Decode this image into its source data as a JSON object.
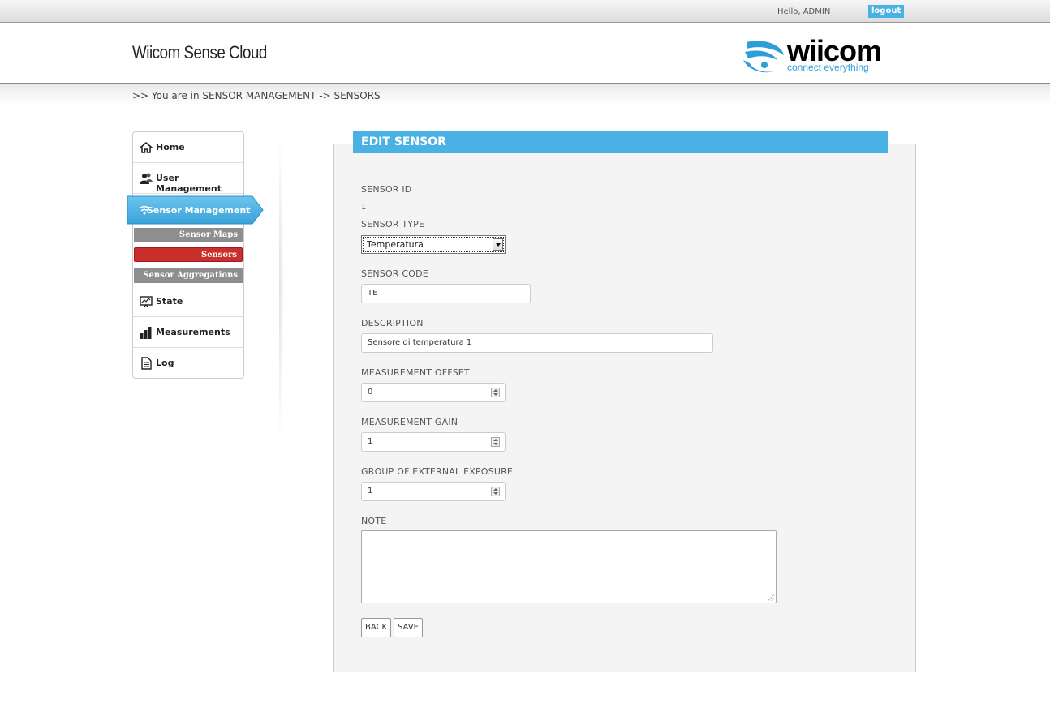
{
  "topbar": {
    "greeting": "Hello,  ADMIN",
    "logout_label": "logout"
  },
  "header": {
    "app_title": "Wiicom Sense Cloud",
    "logo_word": "wiicom",
    "logo_tagline": "connect everything"
  },
  "breadcrumb": ">> You are in SENSOR MANAGEMENT -> SENSORS",
  "sidebar": {
    "items": [
      {
        "label": "Home",
        "icon": "home-icon"
      },
      {
        "label": "User Management",
        "icon": "users-icon"
      },
      {
        "label": "Sensor Management",
        "icon": "wifi-icon",
        "active": true
      },
      {
        "label": "State",
        "icon": "monitor-icon"
      },
      {
        "label": "Measurements",
        "icon": "bar-chart-icon"
      },
      {
        "label": "Log",
        "icon": "document-icon"
      }
    ],
    "subitems": [
      {
        "label": "Sensor Maps"
      },
      {
        "label": "Sensors",
        "active": true
      },
      {
        "label": "Sensor Aggregations"
      }
    ]
  },
  "form": {
    "title": "EDIT SENSOR",
    "sensor_id_label": "SENSOR ID",
    "sensor_id_value": "1",
    "sensor_type_label": "SENSOR TYPE",
    "sensor_type_value": "Temperatura",
    "sensor_code_label": "SENSOR CODE",
    "sensor_code_value": "TE",
    "description_label": "DESCRIPTION",
    "description_value": "Sensore di temperatura 1",
    "offset_label": "MEASUREMENT OFFSET",
    "offset_value": "0",
    "gain_label": "MEASUREMENT GAIN",
    "gain_value": "1",
    "group_label": "GROUP OF EXTERNAL EXPOSURE",
    "group_value": "1",
    "note_label": "NOTE",
    "note_value": "",
    "back_label": "BACK",
    "save_label": "SAVE"
  },
  "colors": {
    "accent": "#49b1e3",
    "active_sub": "#c9302c",
    "sub_bg": "#8e8e8e"
  }
}
